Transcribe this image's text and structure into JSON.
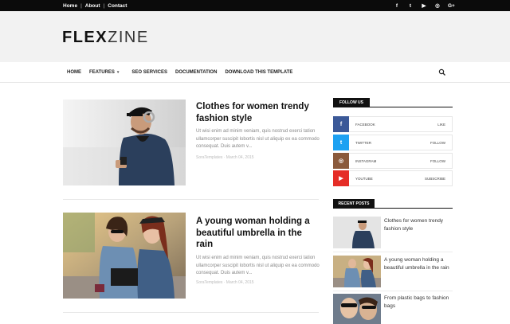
{
  "topbar": {
    "links": [
      "Home",
      "About",
      "Contact"
    ],
    "social": [
      {
        "icon": "facebook-icon",
        "glyph": "f"
      },
      {
        "icon": "twitter-icon",
        "glyph": "t"
      },
      {
        "icon": "youtube-icon",
        "glyph": "▶"
      },
      {
        "icon": "instagram-icon",
        "glyph": "◎"
      },
      {
        "icon": "googleplus-icon",
        "glyph": "G+"
      }
    ]
  },
  "header": {
    "logo_bold": "FLEX",
    "logo_thin": "ZINE"
  },
  "nav": {
    "items": [
      "HOME",
      "FEATURES",
      "SEO SERVICES",
      "DOCUMENTATION",
      "DOWNLOAD THIS TEMPLATE"
    ],
    "dropdown_glyph": "▾"
  },
  "posts": [
    {
      "title": "Clothes for women trendy fashion style",
      "excerpt": "Ut wisi enim ad minim veniam, quis nostrud exerci tation ullamcorper suscipit lobortis nisl ut aliquip ex ea commodo consequat. Duis autem v...",
      "meta": "SoraTemplates · March 04, 2015"
    },
    {
      "title": "A young woman holding a beautiful umbrella in the rain",
      "excerpt": "Ut wisi enim ad minim veniam, quis nostrud exerci tation ullamcorper suscipit lobortis nisl ut aliquip ex ea commodo consequat. Duis autem v...",
      "meta": "SoraTemplates · March 04, 2015"
    }
  ],
  "sidebar": {
    "follow_title": "FOLLOW US",
    "follow": [
      {
        "name": "FACEBOOK",
        "action": "LIKE",
        "color": "#3b5998",
        "glyph": "f",
        "icon": "facebook-icon"
      },
      {
        "name": "TWITTER",
        "action": "FOLLOW",
        "color": "#1da1f2",
        "glyph": "t",
        "icon": "twitter-icon"
      },
      {
        "name": "INSTAGRAM",
        "action": "FOLLOW",
        "color": "#8a5a3c",
        "glyph": "◎",
        "icon": "instagram-icon"
      },
      {
        "name": "YOUTUBE",
        "action": "SUBSCRIBE",
        "color": "#e52d27",
        "glyph": "▶",
        "icon": "youtube-icon"
      }
    ],
    "recent_title": "RECENT POSTS",
    "recent": [
      {
        "title": "Clothes for women trendy fashion style"
      },
      {
        "title": "A young woman holding a beautiful umbrella in the rain"
      },
      {
        "title": "From plastic bags to fashion bags"
      }
    ]
  }
}
